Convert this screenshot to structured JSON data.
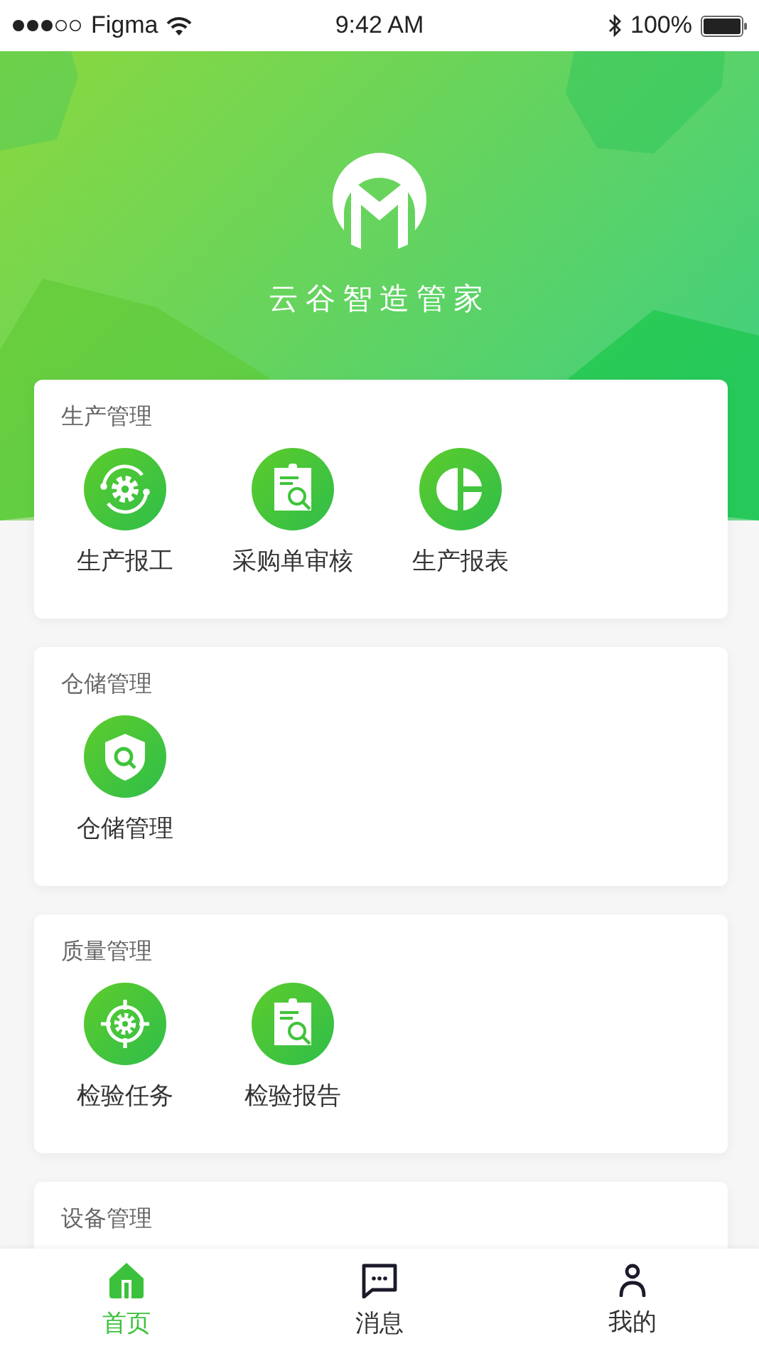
{
  "status_bar": {
    "carrier": "Figma",
    "time": "9:42 AM",
    "battery": "100%"
  },
  "header": {
    "app_name": "云谷智造管家"
  },
  "sections": [
    {
      "title": "生产管理",
      "items": [
        {
          "label": "生产报工",
          "kind": "gearsync"
        },
        {
          "label": "采购单审核",
          "kind": "clipboard"
        },
        {
          "label": "生产报表",
          "kind": "piechart"
        }
      ]
    },
    {
      "title": "仓储管理",
      "items": [
        {
          "label": "仓储管理",
          "kind": "shield"
        }
      ]
    },
    {
      "title": "质量管理",
      "items": [
        {
          "label": "检验任务",
          "kind": "target"
        },
        {
          "label": "检验报告",
          "kind": "clipboard"
        }
      ]
    },
    {
      "title": "设备管理"
    }
  ],
  "tab_bar": [
    {
      "label": "首页",
      "kind": "home",
      "selected": true
    },
    {
      "label": "消息",
      "kind": "chat",
      "selected": false
    },
    {
      "label": "我的",
      "kind": "profile",
      "selected": false
    }
  ]
}
